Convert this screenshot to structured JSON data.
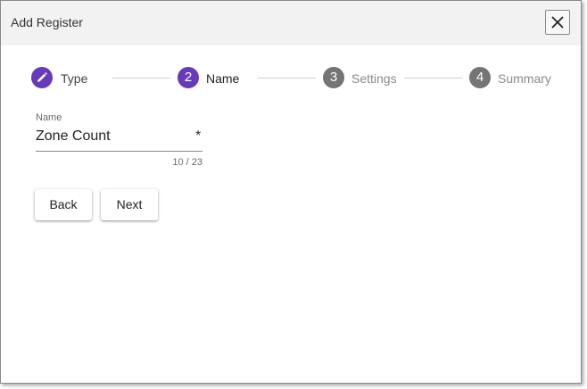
{
  "dialog": {
    "title": "Add Register"
  },
  "stepper": {
    "steps": [
      {
        "number": "",
        "label": "Type",
        "state": "completed",
        "icon": "pencil-icon"
      },
      {
        "number": "2",
        "label": "Name",
        "state": "active"
      },
      {
        "number": "3",
        "label": "Settings",
        "state": "pending"
      },
      {
        "number": "4",
        "label": "Summary",
        "state": "pending"
      }
    ]
  },
  "form": {
    "name_field": {
      "label": "Name",
      "value": "Zone Count",
      "required_marker": "*",
      "counter": "10 / 23"
    }
  },
  "buttons": {
    "back_label": "Back",
    "next_label": "Next"
  },
  "colors": {
    "accent": "#673ab7",
    "pending_step": "#757575",
    "titlebar_bg": "#f2f2f2"
  }
}
